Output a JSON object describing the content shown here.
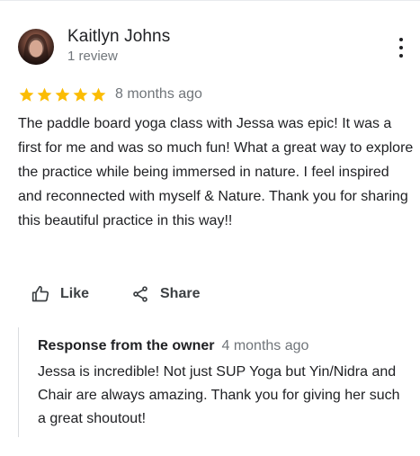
{
  "review": {
    "author_name": "Kaitlyn Johns",
    "author_meta": "1 review",
    "rating": 5,
    "rating_max": 5,
    "date": "8 months ago",
    "text": "The paddle board yoga class with Jessa was epic! It was a first for me and was so much fun! What a great way to explore the practice while being immersed in nature. I feel inspired and reconnected with myself & Nature. Thank you for sharing this beautiful practice in this way!!"
  },
  "actions": {
    "like_label": "Like",
    "share_label": "Share"
  },
  "owner_response": {
    "label": "Response from the owner",
    "date": "4 months ago",
    "text": "Jessa is incredible! Not just SUP Yoga but Yin/Nidra and Chair are always amazing. Thank you for giving her such a great shoutout!"
  },
  "icons": {
    "more": "more-vert-icon",
    "star": "star-icon",
    "like": "thumb-up-icon",
    "share": "share-icon"
  },
  "colors": {
    "star": "#fbbc04",
    "text": "#202124",
    "muted": "#70757a",
    "action": "#3c4043",
    "divider": "#dadce0"
  }
}
